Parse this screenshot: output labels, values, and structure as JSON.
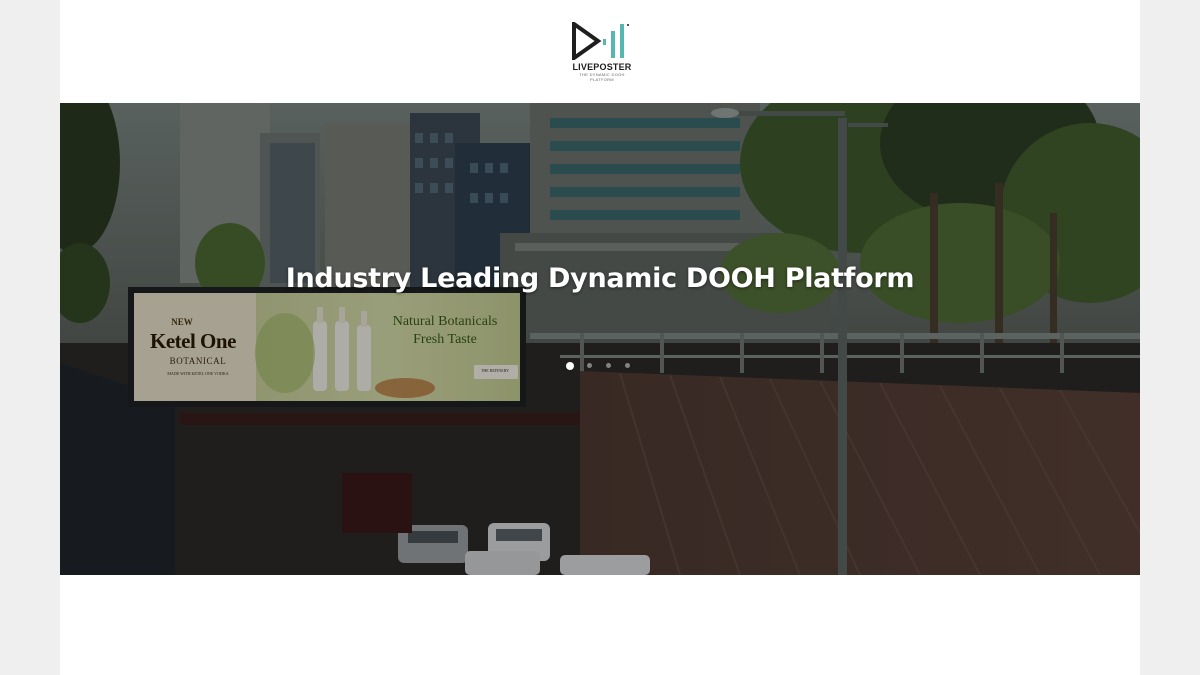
{
  "brand": {
    "name": "LIVEPOSTER",
    "tagline": "THE DYNAMIC DOOH PLATFORM",
    "colors": {
      "dark": "#1e1e1e",
      "teal": "#56b7b2"
    }
  },
  "hero": {
    "title": "Industry Leading Dynamic DOOH Platform",
    "slides_count": 4,
    "active_slide": 1
  },
  "billboard": {
    "new_label": "NEW",
    "brand": "Ketel One",
    "sub": "BOTANICAL",
    "made_with": "MADE WITH KETEL ONE VODKA",
    "headline_1": "Natural Botanicals",
    "headline_2": "Fresh Taste",
    "corner": "THE REFINERY"
  }
}
